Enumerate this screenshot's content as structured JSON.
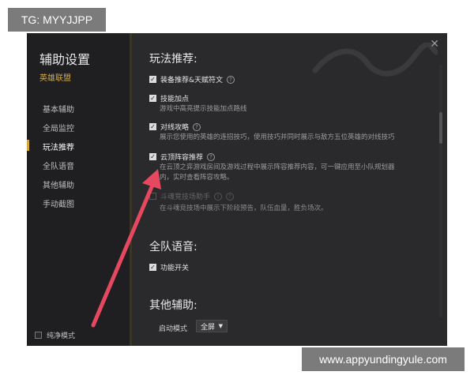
{
  "watermark": {
    "tg": "TG: MYYJJPP",
    "site": "www.appyundingyule.com"
  },
  "sidebar": {
    "title": "辅助设置",
    "subtitle": "英雄联盟",
    "items": [
      {
        "label": "基本辅助"
      },
      {
        "label": "全局监控"
      },
      {
        "label": "玩法推荐",
        "active": true
      },
      {
        "label": "全队语音"
      },
      {
        "label": "其他辅助"
      },
      {
        "label": "手动截图"
      }
    ],
    "pure_mode": "纯净模式"
  },
  "main": {
    "section1": {
      "title": "玩法推荐:",
      "options": [
        {
          "label": "装备推荐&天赋符文",
          "checked": true,
          "help": "?"
        },
        {
          "label": "技能加点",
          "checked": true,
          "desc": "游戏中高亮提示技能加点路线"
        },
        {
          "label": "对线攻略",
          "checked": true,
          "help": "?",
          "desc": "展示您使用的英雄的连招技巧，使用技巧并同时展示与敌方五位英雄的对线技巧"
        },
        {
          "label": "云顶阵容推荐",
          "checked": true,
          "help": "?",
          "desc1": "在云顶之弈游戏房间及游戏过程中展示阵容推荐内容，可一键应用至小队规划器",
          "desc2": "内，实时查看阵容攻略。"
        },
        {
          "label": "斗魂竞技场助手",
          "checked": false,
          "help": "!",
          "help2": "?",
          "desc": "在斗魂竞技场中展示下阶段预告，队伍血量，胜负场次。"
        }
      ]
    },
    "section2": {
      "title": "全队语音:",
      "options": [
        {
          "label": "功能开关",
          "checked": true
        }
      ]
    },
    "section3": {
      "title": "其他辅助:",
      "mode_label": "启动模式",
      "mode_value": "全屏"
    }
  },
  "colors": {
    "accent": "#d7a93a",
    "arrow": "#e5485f"
  }
}
